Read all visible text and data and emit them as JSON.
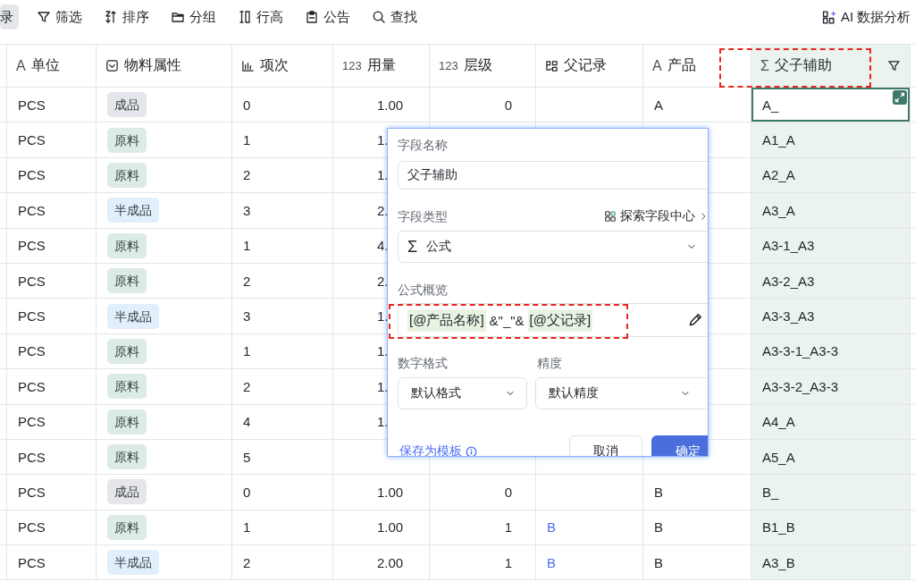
{
  "toolbar": {
    "items": [
      {
        "label": "录",
        "selected": true
      },
      {
        "label": "筛选",
        "kind": "filter",
        "selected": false
      },
      {
        "label": "排序",
        "kind": "sort",
        "selected": false
      },
      {
        "label": "分组",
        "kind": "folder",
        "selected": false
      },
      {
        "label": "行高",
        "kind": "rowheight",
        "selected": false
      },
      {
        "label": "公告",
        "kind": "notice",
        "selected": false
      },
      {
        "label": "查找",
        "kind": "search",
        "selected": false
      }
    ],
    "ai_button": {
      "label": "AI 数据分析"
    }
  },
  "table": {
    "columns": [
      {
        "label": "单位",
        "kind": "text",
        "glyph": "A",
        "selected": false
      },
      {
        "label": "物料属性",
        "kind": "select",
        "selected": false
      },
      {
        "label": "项次",
        "kind": "autonum",
        "selected": false
      },
      {
        "label": "用量",
        "kind": "decimal",
        "glyph": "123",
        "selected": false
      },
      {
        "label": "层级",
        "kind": "integer",
        "glyph": "123",
        "selected": false
      },
      {
        "label": "父记录",
        "kind": "link",
        "selected": false
      },
      {
        "label": "产品",
        "kind": "text",
        "glyph": "A",
        "selected": false
      },
      {
        "label": "父子辅助",
        "kind": "formula",
        "glyph": "Σ",
        "selected": true
      }
    ],
    "rows": [
      {
        "selected": true,
        "cells": [
          "PCS",
          {
            "label": "成品",
            "color": "#e4e6eb"
          },
          "0",
          "1.00",
          "0",
          "",
          "A",
          "A_"
        ]
      },
      {
        "selected": false,
        "cells": [
          "PCS",
          {
            "label": "原料",
            "color": "#dcece5"
          },
          "1",
          "1.",
          "",
          "",
          "",
          "A1_A"
        ]
      },
      {
        "selected": false,
        "cells": [
          "PCS",
          {
            "label": "原料",
            "color": "#dcece5"
          },
          "2",
          "1.",
          "",
          "",
          "",
          "A2_A"
        ]
      },
      {
        "selected": false,
        "cells": [
          "PCS",
          {
            "label": "半成品",
            "color": "#e1eefb"
          },
          "3",
          "2.",
          "",
          "",
          "",
          "A3_A"
        ]
      },
      {
        "selected": false,
        "cells": [
          "PCS",
          {
            "label": "原料",
            "color": "#dcece5"
          },
          "1",
          "4.",
          "",
          "",
          "",
          "A3-1_A3"
        ]
      },
      {
        "selected": false,
        "cells": [
          "PCS",
          {
            "label": "原料",
            "color": "#dcece5"
          },
          "2",
          "2.",
          "",
          "",
          "",
          "A3-2_A3"
        ]
      },
      {
        "selected": false,
        "cells": [
          "PCS",
          {
            "label": "半成品",
            "color": "#e1eefb"
          },
          "3",
          "1.",
          "",
          "",
          "",
          "A3-3_A3"
        ]
      },
      {
        "selected": false,
        "cells": [
          "PCS",
          {
            "label": "原料",
            "color": "#dcece5"
          },
          "1",
          "1.",
          "",
          "",
          "",
          "A3-3-1_A3-3"
        ]
      },
      {
        "selected": false,
        "cells": [
          "PCS",
          {
            "label": "原料",
            "color": "#dcece5"
          },
          "2",
          "1.",
          "",
          "",
          "",
          "A3-3-2_A3-3"
        ]
      },
      {
        "selected": false,
        "cells": [
          "PCS",
          {
            "label": "原料",
            "color": "#dcece5"
          },
          "4",
          "1.",
          "",
          "",
          "",
          "A4_A"
        ]
      },
      {
        "selected": false,
        "cells": [
          "PCS",
          {
            "label": "原料",
            "color": "#dcece5"
          },
          "5",
          "",
          "",
          "",
          "",
          "A5_A"
        ]
      },
      {
        "selected": false,
        "cells": [
          "PCS",
          {
            "label": "成品",
            "color": "#e4e6eb"
          },
          "0",
          "1.00",
          "0",
          "",
          "B",
          "B_"
        ]
      },
      {
        "selected": false,
        "cells": [
          "PCS",
          {
            "label": "原料",
            "color": "#dcece5"
          },
          "1",
          "1.00",
          "1",
          "B",
          "B",
          "B1_B"
        ]
      },
      {
        "selected": false,
        "cells": [
          "PCS",
          {
            "label": "半成品",
            "color": "#e1eefb"
          },
          "2",
          "2.00",
          "1",
          "B",
          "B",
          "A3_B"
        ]
      }
    ]
  },
  "field_editor": {
    "name_label": "字段名称",
    "name_value": "父子辅助",
    "type_label": "字段类型",
    "explore_link": "探索字段中心",
    "type_value": "公式",
    "type_glyph": "Σ",
    "formula_label": "公式概览",
    "formula": [
      {
        "kind": "field",
        "text": "[@产品名称]"
      },
      {
        "kind": "operator",
        "text": "&\"_\"&"
      },
      {
        "kind": "field",
        "text": "[@父记录]"
      }
    ],
    "format_label": "数字格式",
    "format_value": "默认格式",
    "precision_label": "精度",
    "precision_value": "默认精度",
    "template_link": "保存为模板",
    "cancel_button": "取消",
    "confirm_button": "确定"
  }
}
